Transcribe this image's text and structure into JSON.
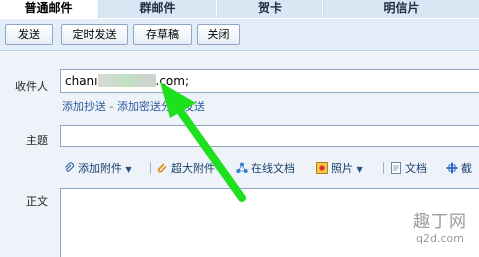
{
  "tabs": [
    {
      "label": "普通邮件",
      "active": true
    },
    {
      "label": "群邮件",
      "active": false
    },
    {
      "label": "贺卡",
      "active": false
    },
    {
      "label": "明信片",
      "active": false
    }
  ],
  "toolbar": {
    "send_label": "发送",
    "timed_send_label": "定时发送",
    "save_draft_label": "存草稿",
    "close_label": "关闭"
  },
  "compose": {
    "to_label": "收件人",
    "to_value_prefix": "chanı",
    "to_value_suffix": ".com;",
    "cc_link": "添加抄送",
    "separator": " - ",
    "bcc_link_partial": "添加密送",
    "separate_send_partial": "分别发送",
    "subject_label": "主题",
    "subject_value": "",
    "body_label": "正文"
  },
  "attach_bar": {
    "attach_label": "添加附件",
    "super_attach_label": "超大附件",
    "online_doc_label": "在线文档",
    "photo_label": "照片",
    "doc_label": "文档",
    "screenshot_label": "截"
  },
  "watermark": {
    "top": "趣丁网",
    "bottom": "q2d.com"
  },
  "colors": {
    "arrow": "#1fe01f",
    "link": "#2a5b9a",
    "tab_bar": "#cfe0f1"
  }
}
